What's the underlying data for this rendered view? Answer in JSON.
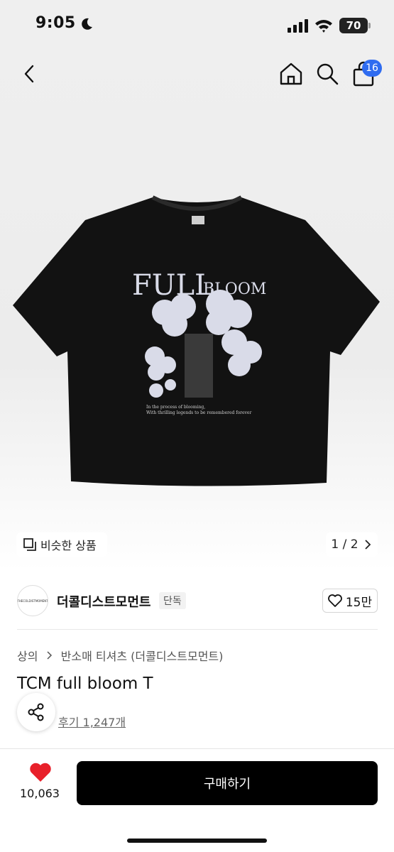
{
  "status_bar": {
    "time": "9:05",
    "battery": "70"
  },
  "header": {
    "cart_count": "16"
  },
  "product_image": {
    "print_title_big": "FULL",
    "print_title_small": "BLOOM",
    "print_caption_line1": "In the process of blooming,",
    "print_caption_line2": "With thrilling legends to be remembered forever"
  },
  "gallery": {
    "similar_label": "비슷한 상품",
    "page_indicator": "1 / 2"
  },
  "brand": {
    "logo_text": "THECOLDISTMOMENT",
    "name": "더콜디스트모먼트",
    "badge": "단독",
    "likes": "15만"
  },
  "breadcrumb": {
    "items": [
      "상의",
      "반소매 티셔츠 (더콜디스트모먼트)"
    ]
  },
  "product": {
    "title": "TCM full bloom T",
    "reviews": "후기 1,247개"
  },
  "bottom_bar": {
    "wish_count": "10,063",
    "buy_label": "구매하기"
  },
  "colors": {
    "accent_blue": "#2f6cf0",
    "heart_red": "#e8202a",
    "buy_button": "#000000"
  }
}
